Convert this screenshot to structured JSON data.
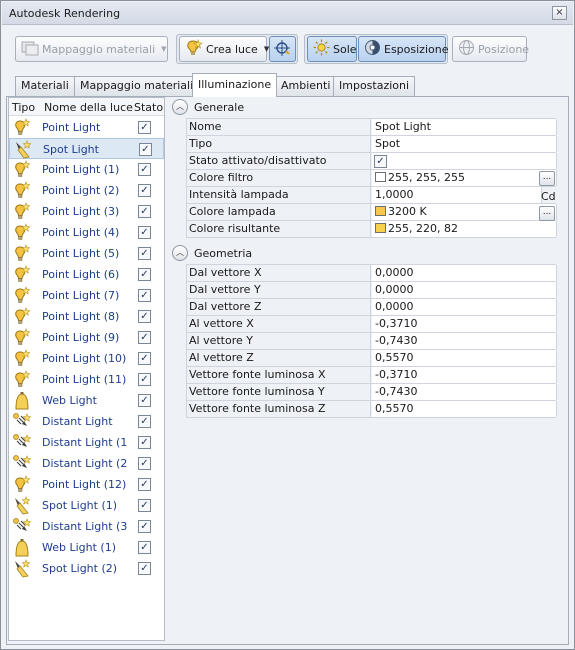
{
  "window": {
    "title": "Autodesk Rendering",
    "close_glyph": "×"
  },
  "toolbar": {
    "material_mapping": {
      "label": "Mappaggio materiali",
      "icon": "material-mapping-icon",
      "enabled": false
    },
    "create_light": {
      "label": "Crea luce",
      "icon": "light-bulb-icon"
    },
    "light_target": {
      "icon": "light-target-icon"
    },
    "sun": {
      "label": "Sole",
      "icon": "sun-icon",
      "active": true
    },
    "exposure": {
      "label": "Esposizione",
      "icon": "exposure-icon",
      "active": true
    },
    "position": {
      "label": "Posizione",
      "icon": "globe-icon",
      "enabled": false
    }
  },
  "tabs": [
    {
      "label": "Materiali",
      "active": false
    },
    {
      "label": "Mappaggio materiali",
      "active": false
    },
    {
      "label": "Illuminazione",
      "active": true
    },
    {
      "label": "Ambienti",
      "active": false
    },
    {
      "label": "Impostazioni",
      "active": false
    }
  ],
  "light_list": {
    "headers": {
      "type": "Tipo",
      "name": "Nome della luce",
      "status": "Stato"
    },
    "check_glyph": "✓",
    "items": [
      {
        "name": "Point Light",
        "kind": "point",
        "on": true,
        "selected": false
      },
      {
        "name": "Spot Light",
        "kind": "spot",
        "on": true,
        "selected": true
      },
      {
        "name": "Point Light (1)",
        "kind": "point",
        "on": true,
        "selected": false
      },
      {
        "name": "Point Light (2)",
        "kind": "point",
        "on": true,
        "selected": false
      },
      {
        "name": "Point Light (3)",
        "kind": "point",
        "on": true,
        "selected": false
      },
      {
        "name": "Point Light (4)",
        "kind": "point",
        "on": true,
        "selected": false
      },
      {
        "name": "Point Light (5)",
        "kind": "point",
        "on": true,
        "selected": false
      },
      {
        "name": "Point Light (6)",
        "kind": "point",
        "on": true,
        "selected": false
      },
      {
        "name": "Point Light (7)",
        "kind": "point",
        "on": true,
        "selected": false
      },
      {
        "name": "Point Light (8)",
        "kind": "point",
        "on": true,
        "selected": false
      },
      {
        "name": "Point Light (9)",
        "kind": "point",
        "on": true,
        "selected": false
      },
      {
        "name": "Point Light (10)",
        "kind": "point",
        "on": true,
        "selected": false
      },
      {
        "name": "Point Light (11)",
        "kind": "point",
        "on": true,
        "selected": false
      },
      {
        "name": "Web Light",
        "kind": "web",
        "on": true,
        "selected": false
      },
      {
        "name": "Distant Light",
        "kind": "distant",
        "on": true,
        "selected": false
      },
      {
        "name": "Distant Light (1",
        "kind": "distant",
        "on": true,
        "selected": false
      },
      {
        "name": "Distant Light (2",
        "kind": "distant",
        "on": true,
        "selected": false
      },
      {
        "name": "Point Light (12)",
        "kind": "point",
        "on": true,
        "selected": false
      },
      {
        "name": "Spot Light (1)",
        "kind": "spot",
        "on": true,
        "selected": false
      },
      {
        "name": "Distant Light (3",
        "kind": "distant",
        "on": true,
        "selected": false
      },
      {
        "name": "Web Light (1)",
        "kind": "web",
        "on": true,
        "selected": false
      },
      {
        "name": "Spot Light (2)",
        "kind": "spot",
        "on": true,
        "selected": false
      }
    ]
  },
  "properties": {
    "general": {
      "title": "Generale",
      "collapse_glyph": "︿",
      "name": {
        "label": "Nome",
        "value": "Spot Light"
      },
      "type": {
        "label": "Tipo",
        "value": "Spot"
      },
      "state": {
        "label": "Stato attivato/disattivato",
        "checked": true,
        "glyph": "✓"
      },
      "filter_color": {
        "label": "Colore filtro",
        "value": "255, 255, 255",
        "swatch": "#ffffff"
      },
      "intensity": {
        "label": "Intensità lampada",
        "value": "1,0000",
        "unit": "Cd"
      },
      "lamp_color": {
        "label": "Colore lampada",
        "value": "3200 K",
        "swatch": "#f7c84b"
      },
      "resulting_color": {
        "label": "Colore risultante",
        "value": "255, 220, 82",
        "swatch": "#f7d04e"
      },
      "ellipsis_label": "..."
    },
    "geometry": {
      "title": "Geometria",
      "collapse_glyph": "︿",
      "rows": [
        {
          "label": "Dal vettore X",
          "value": "0,0000"
        },
        {
          "label": "Dal vettore Y",
          "value": "0,0000"
        },
        {
          "label": "Dal vettore Z",
          "value": "0,0000"
        },
        {
          "label": "Al vettore X",
          "value": "-0,3710"
        },
        {
          "label": "Al vettore Y",
          "value": "-0,7430"
        },
        {
          "label": "Al vettore Z",
          "value": "0,5570"
        },
        {
          "label": "Vettore fonte luminosa X",
          "value": "-0,3710"
        },
        {
          "label": "Vettore fonte luminosa Y",
          "value": "-0,7430"
        },
        {
          "label": "Vettore fonte luminosa Z",
          "value": "0,5570"
        }
      ]
    }
  },
  "colors": {
    "accent_text": "#1e3d8c",
    "selection": "#dde8f5",
    "panel": "#eef1f6",
    "bulb_yellow": "#f5c242"
  }
}
